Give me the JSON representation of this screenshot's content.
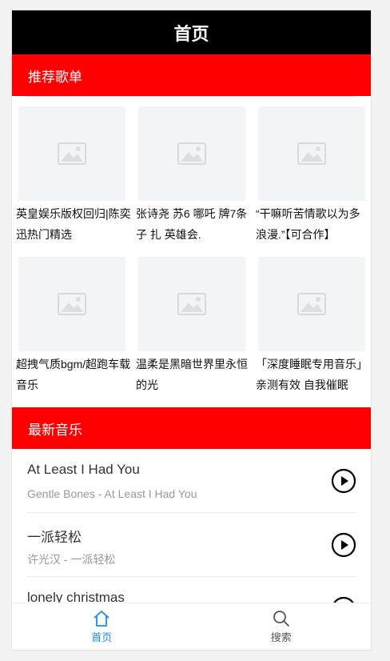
{
  "header": {
    "title": "首页"
  },
  "recommended": {
    "heading": "推荐歌单",
    "playlists": [
      {
        "title": "英皇娱乐版权回归|陈奕迅热门精选"
      },
      {
        "title": "张诗尧 苏6 哪吒 牌7条子 扎 英雄会."
      },
      {
        "title": "“干嘛听苦情歌以为多浪漫.”【可合作】"
      },
      {
        "title": "超拽气质bgm/超跑车载音乐"
      },
      {
        "title": "温柔是黑暗世界里永恒的光"
      },
      {
        "title": "「深度睡眠专用音乐」亲测有效 自我催眠"
      }
    ]
  },
  "latest": {
    "heading": "最新音乐",
    "songs": [
      {
        "name": "At Least I Had You",
        "sub": "Gentle Bones - At Least I Had You"
      },
      {
        "name": "一派轻松",
        "sub": "许光汉 - 一派轻松"
      },
      {
        "name": "lonely christmas",
        "sub": ""
      }
    ]
  },
  "tabbar": {
    "home_label": "首页",
    "search_label": "搜索"
  },
  "colors": {
    "accent": "#ff0000",
    "topbar": "#000000",
    "active_tab": "#1989fa"
  }
}
